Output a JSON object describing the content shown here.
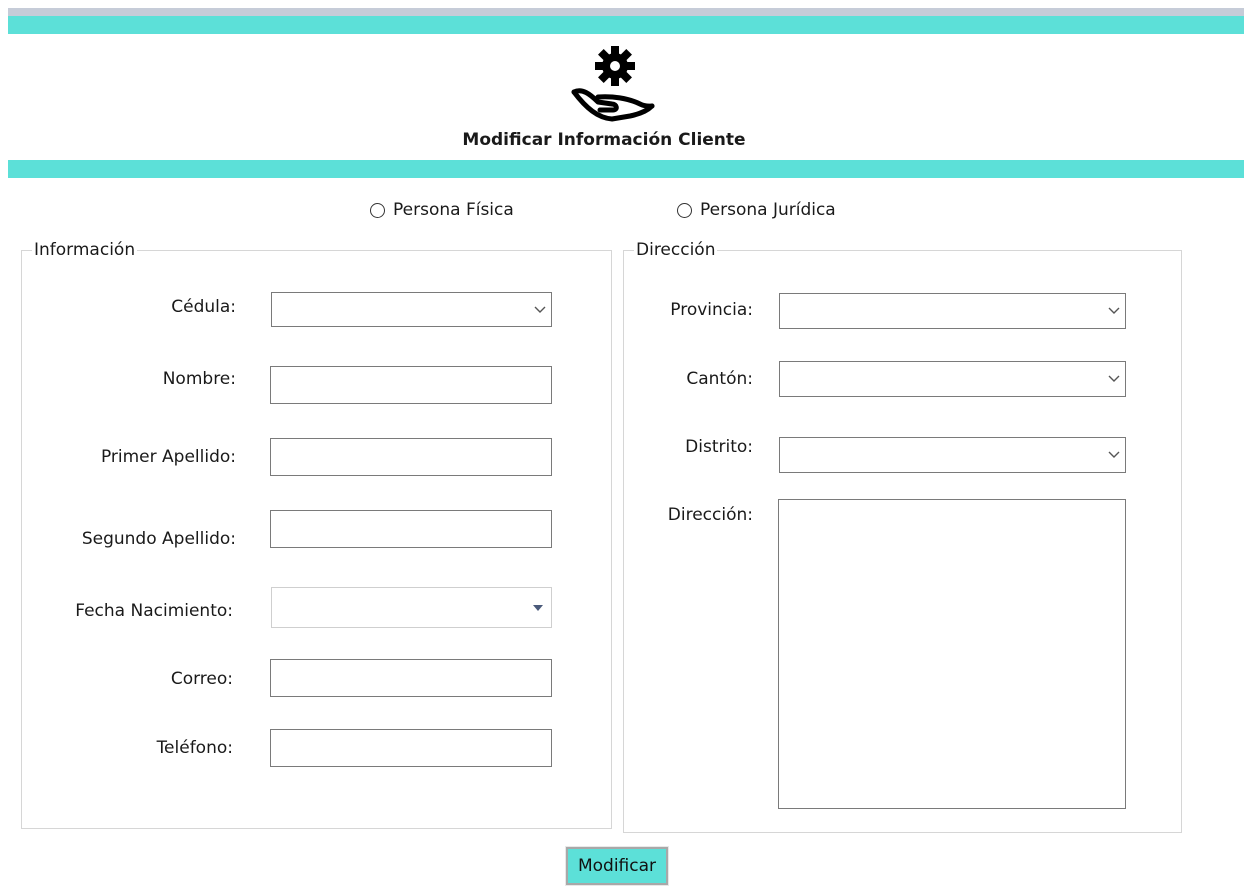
{
  "header": {
    "title": "Modificar Información Cliente"
  },
  "radios": {
    "fisica": "Persona Física",
    "juridica": "Persona Jurídica"
  },
  "info": {
    "legend": "Información",
    "cedula_label": "Cédula:",
    "cedula_value": "",
    "nombre_label": "Nombre:",
    "nombre_value": "",
    "apellido1_label": "Primer Apellido:",
    "apellido1_value": "",
    "apellido2_label": "Segundo Apellido:",
    "apellido2_value": "",
    "fecha_label": "Fecha Nacimiento:",
    "fecha_value": "",
    "correo_label": "Correo:",
    "correo_value": "",
    "telefono_label": "Teléfono:",
    "telefono_value": ""
  },
  "direccion": {
    "legend": "Dirección",
    "provincia_label": "Provincia:",
    "provincia_value": "",
    "canton_label": "Cantón:",
    "canton_value": "",
    "distrito_label": "Distrito:",
    "distrito_value": "",
    "direccion_label": "Dirección:",
    "direccion_value": ""
  },
  "actions": {
    "modificar_label": "Modificar"
  },
  "colors": {
    "accent": "#5ce0d8",
    "top_strip": "#c6ccd8"
  },
  "icons": {
    "logo": "hand-gear-icon",
    "dropdown": "chevron-down-icon",
    "date_dropdown": "caret-down-icon"
  }
}
